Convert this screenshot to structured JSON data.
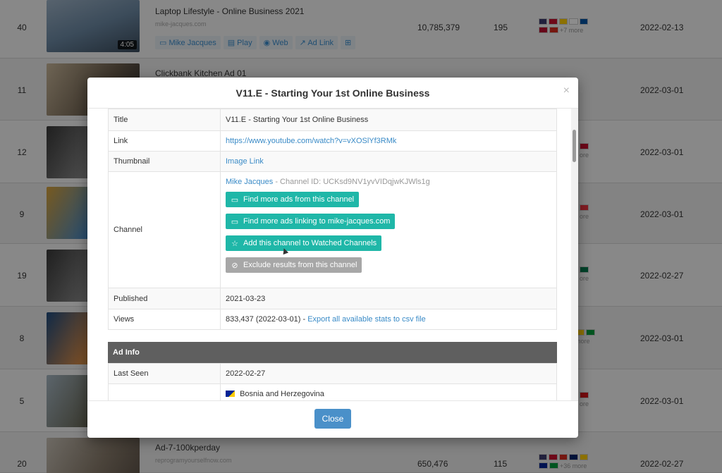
{
  "modal": {
    "title": "V11.E - Starting Your 1st Online Business",
    "close_x": "×",
    "close_label": "Close",
    "details": {
      "title_label": "Title",
      "title_value": "V11.E - Starting Your 1st Online Business",
      "link_label": "Link",
      "link_value": "https://www.youtube.com/watch?v=vXOSlYf3RMk",
      "thumbnail_label": "Thumbnail",
      "thumbnail_value": "Image Link",
      "channel_label": "Channel",
      "channel_name": "Mike Jacques",
      "channel_id": "- Channel ID: UCKsd9NV1yvVIDqjwKJWls1g",
      "btn_find_channel": "Find more ads from this channel",
      "btn_find_linking": "Find more ads linking to mike-jacques.com",
      "btn_watch": "Add this channel to Watched Channels",
      "btn_exclude": "Exclude results from this channel",
      "published_label": "Published",
      "published_value": "2021-03-23",
      "views_label": "Views",
      "views_value": "833,437 (2022-03-01) -",
      "views_export": "Export all available stats to csv file"
    },
    "ad_info": {
      "heading": "Ad Info",
      "last_seen_label": "Last Seen",
      "last_seen_value": "2022-02-27",
      "country": "Bosnia and Herzegovina"
    }
  },
  "background": {
    "rows": [
      {
        "rank": "40",
        "title": "Laptop Lifestyle - Online Business 2021",
        "site": "mike-jacques.com",
        "duration": "4:05",
        "views": "10,785,379",
        "likes": "195",
        "more": "+7 more",
        "date": "2022-02-13"
      },
      {
        "rank": "11",
        "title": "Clickbank Kitchen Ad 01",
        "date": "2022-03-01"
      },
      {
        "rank": "12",
        "date": "2022-03-01",
        "more": "ore"
      },
      {
        "rank": "9",
        "date": "2022-03-01",
        "more": "ore"
      },
      {
        "rank": "19",
        "date": "2022-02-27",
        "more": "ore"
      },
      {
        "rank": "8",
        "date": "2022-03-01",
        "more": "more"
      },
      {
        "rank": "5",
        "date": "2022-03-01",
        "more": "ore"
      },
      {
        "rank": "20",
        "title": "Ad-7-100kperday",
        "site": "reprogramyourselfnow.com",
        "views": "650,476",
        "likes": "115",
        "more": "+36 more",
        "date": "2022-02-27"
      }
    ],
    "actions": [
      "Mike Jacques",
      "Play",
      "Web",
      "Ad Link"
    ]
  }
}
